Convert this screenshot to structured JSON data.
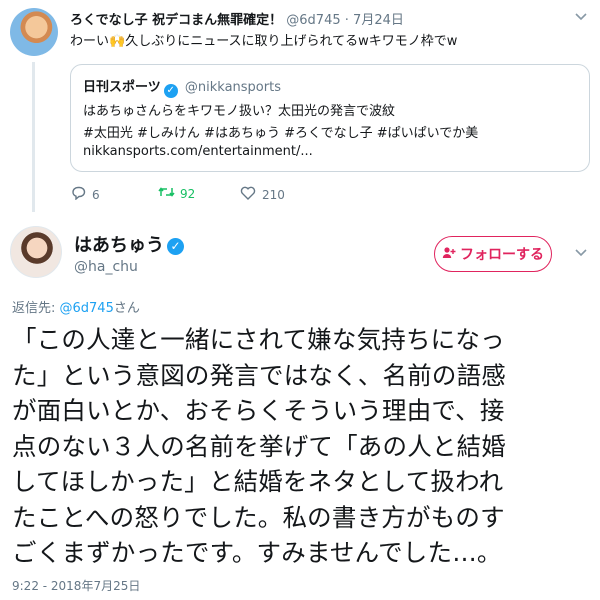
{
  "parent_tweet": {
    "display_name": "ろくでなし子 祝デコまん無罪確定！",
    "handle": "@6d745",
    "separator": "·",
    "date": "7月24日",
    "text_before_emoji": "わーい",
    "emoji": "🙌",
    "text_after_emoji": "久しぶりにニュースに取り上げられてるwキワモノ枠でw",
    "quoted": {
      "display_name": "日刊スポーツ",
      "handle": "@nikkansports",
      "line1": "はあちゅさんらをキワモノ扱い？太田光の発言で波紋",
      "line2": "#太田光 #しみけん #はあちゅう #ろくでなし子 #ぱいぱいでか美",
      "line3": "nikkansports.com/entertainment/..."
    },
    "actions": {
      "reply_count": "6",
      "retweet_count": "92",
      "like_count": "210"
    }
  },
  "main_tweet": {
    "display_name": "はあちゅう",
    "handle": "@ha_chu",
    "follow_label": "フォローする",
    "reply_prefix": "返信先: ",
    "reply_mention": "@6d745",
    "reply_suffix": "さん",
    "body_lines": [
      "「この人達と一緒にされて嫌な気持ちになっ",
      "た」という意図の発言ではなく、名前の語感",
      "が面白いとか、おそらくそういう理由で、接",
      "点のない３人の名前を挙げて「あの人と結婚",
      "してほしかった」と結婚をネタとして扱われ",
      "たことへの怒りでした。私の書き方がものす",
      "ごくまずかったです。すみませんでした…。"
    ],
    "timestamp": "9:22 - 2018年7月25日"
  },
  "icons": {
    "verified": "verified-badge-icon",
    "caret": "chevron-down-icon",
    "reply": "reply-icon",
    "retweet": "retweet-icon",
    "like": "heart-icon",
    "follow": "person-plus-icon"
  },
  "colors": {
    "link_blue": "#1da1f2",
    "follow_pink": "#e0245e",
    "retweet_green": "#17bf63",
    "muted_gray": "#657786"
  }
}
